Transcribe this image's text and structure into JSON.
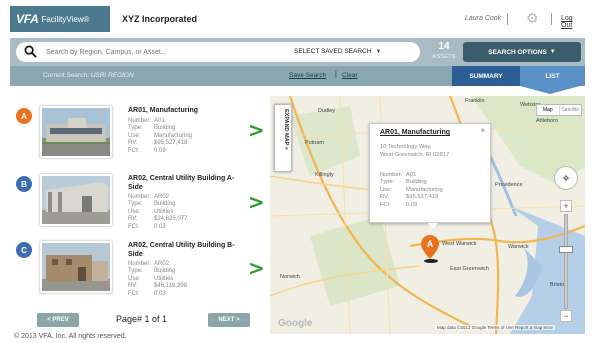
{
  "header": {
    "logo_vfa": "VFA",
    "logo_fv": "FacilityView®",
    "client": "XYZ Incorporated",
    "user": "Laura Cook",
    "logout": "Log Out"
  },
  "search": {
    "placeholder": "Search by Region, Campus, or Asset...",
    "saved_search": "SELECT SAVED SEARCH",
    "assets_count": "14",
    "assets_label": "ASSETS",
    "search_options": "SEARCH OPTIONS"
  },
  "current": {
    "label": "Current Search:",
    "value": "USRI REGION",
    "save_search": "Save Search",
    "clear": "Clear"
  },
  "tabs": {
    "summary": "SUMMARY",
    "list": "LIST"
  },
  "field_labels": {
    "number": "Number:",
    "type": "Type:",
    "use": "Use:",
    "rv": "RV:",
    "fci": "FCI:"
  },
  "items": [
    {
      "badge": "A",
      "name": "AR01, Manufacturing",
      "number": "A01",
      "type": "Building",
      "use": "Manufacturing",
      "rv": "$95,527,418",
      "fci": "0.09"
    },
    {
      "badge": "B",
      "name": "AR02, Central Utility Building A-Side",
      "number": "AR02",
      "type": "Building",
      "use": "Utilities",
      "rv": "$24,825,077",
      "fci": "0.03"
    },
    {
      "badge": "C",
      "name": "AR02, Central Utility Building B-Side",
      "number": "AR02",
      "type": "Building",
      "use": "Utilities",
      "rv": "$46,119,398",
      "fci": "0.03"
    }
  ],
  "pagination": {
    "prev": "< PREV",
    "page": "Page# 1 of 1",
    "next": "NEXT >"
  },
  "copyright": "© 2013 VFA, Inc. All rights reserved.",
  "map": {
    "expand": "EXPAND MAP »",
    "map_type": "Map",
    "satellite": "Satellite",
    "popup": {
      "title": "AR01, Manufacturing",
      "addr1": "10 Technology Way,",
      "addr2": "West Greenwich, RI 02817",
      "number": "A01",
      "type": "Building",
      "use": "Manufacturing",
      "rv": "$95,527,418",
      "fci": "0.09"
    },
    "marker": "A",
    "footer": "Map data ©2013 Google  Terms of Use  Report a map error",
    "google": "Google",
    "towns": {
      "webster": "Webster",
      "franklin": "Franklin",
      "attleboro": "Attleboro",
      "putnam": "Putnam",
      "killingly": "Killingly",
      "dudley": "Dudley",
      "providence": "Providence",
      "warwick": "Warwick",
      "west_warwick": "West Warwick",
      "east_greenwich": "East Greenwich",
      "norwich": "Norwich",
      "bristol": "Bristol"
    }
  }
}
